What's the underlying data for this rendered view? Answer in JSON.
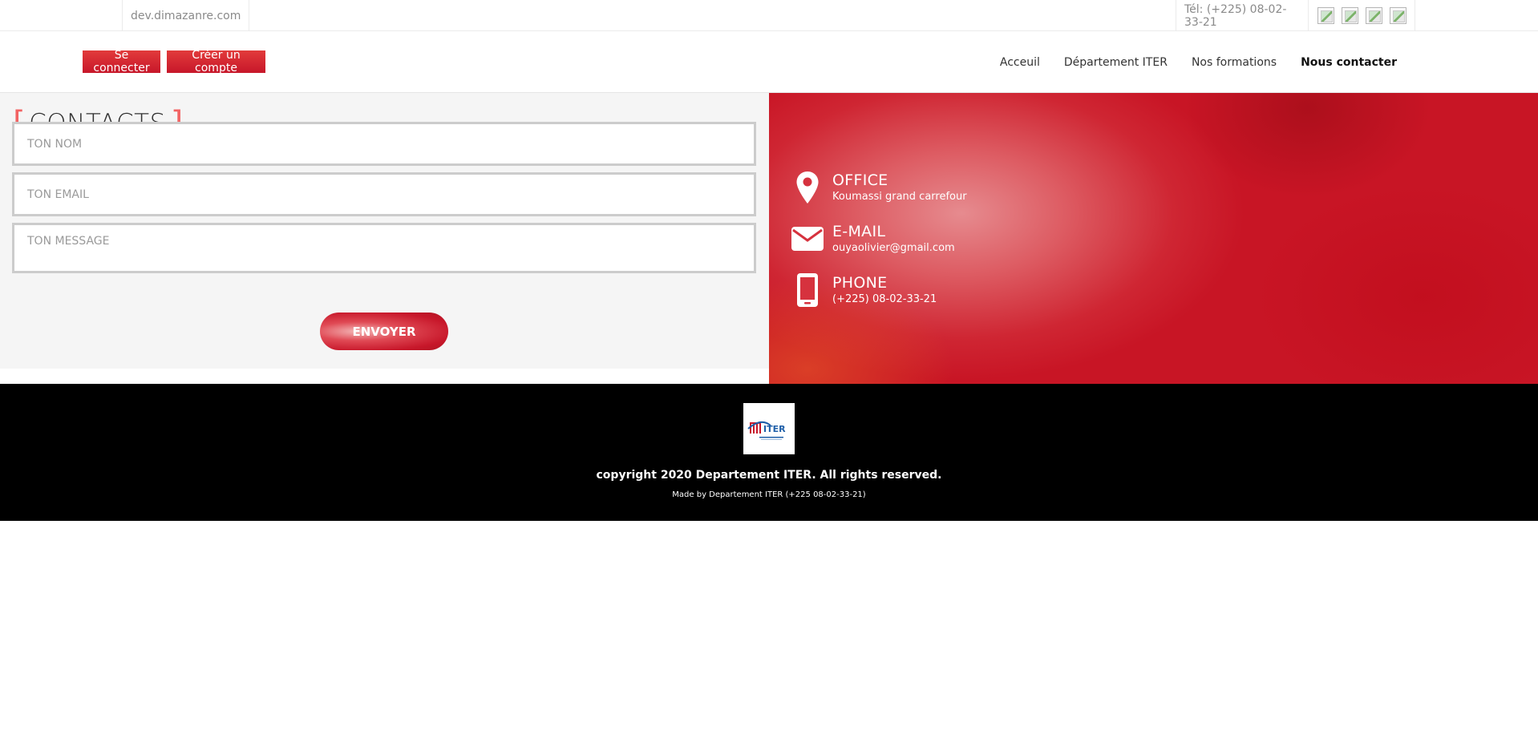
{
  "topbar": {
    "domain": "dev.dimazanre.com",
    "phone": "Tél: (+225) 08-02-33-21",
    "social_icons": [
      "broken-image-icon",
      "broken-image-icon",
      "broken-image-icon",
      "broken-image-icon"
    ]
  },
  "auth": {
    "login_label": "Se connecter",
    "register_label": "Créer un compte"
  },
  "nav": {
    "items": [
      {
        "label": "Acceuil"
      },
      {
        "label": "Département ITER"
      },
      {
        "label": "Nos formations"
      },
      {
        "label": "Nous contacter",
        "active": true
      }
    ]
  },
  "contact": {
    "title": "CONTACTS",
    "name_placeholder": "TON NOM",
    "email_placeholder": "TON EMAIL",
    "message_placeholder": "TON MESSAGE",
    "send_label": "ENVOYER"
  },
  "info": {
    "office": {
      "label": "OFFICE",
      "value": "Koumassi grand carrefour",
      "icon": "map-pin-icon"
    },
    "email": {
      "label": "E-MAIL",
      "value": "ouyaolivier@gmail.com",
      "icon": "envelope-icon"
    },
    "phone": {
      "label": "PHONE",
      "value": "(+225) 08-02-33-21",
      "icon": "mobile-phone-icon"
    }
  },
  "footer": {
    "logo_text": "ITER",
    "copyright": "copyright 2020 Departement ITER. All rights reserved.",
    "made_by": "Made by Departement ITER (+225 08-02-33-21)"
  },
  "colors": {
    "accent": "#c7172a",
    "bracket": "#f26363",
    "footer_bg": "#000000"
  }
}
